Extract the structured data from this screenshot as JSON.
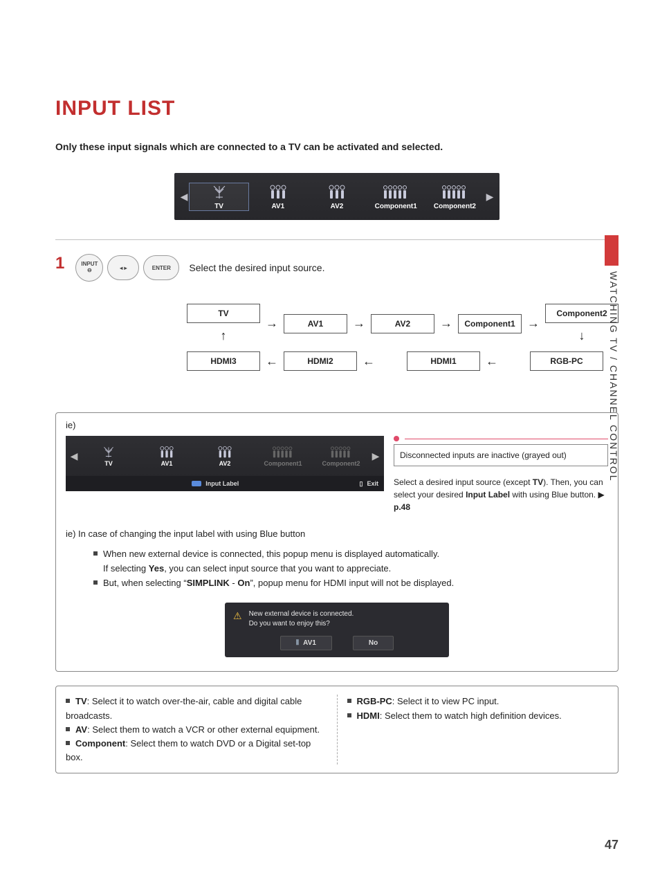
{
  "title": "INPUT LIST",
  "intro": "Only these input signals which are connected to a TV can be activated and selected.",
  "side_label": "WATCHING TV / CHANNEL CONTROL",
  "page_number": "47",
  "top_bar": {
    "items": [
      "TV",
      "AV1",
      "AV2",
      "Component1",
      "Component2"
    ]
  },
  "step1": {
    "num": "1",
    "btn_input": "INPUT",
    "btn_enter": "ENTER",
    "text": "Select the desired input source."
  },
  "flow": {
    "row1": [
      "TV",
      "AV1",
      "AV2",
      "Component1",
      "Component2"
    ],
    "row2": [
      "HDMI3",
      "HDMI2",
      "HDMI1",
      "RGB-PC"
    ]
  },
  "ie": {
    "caption": "ie)",
    "bar_items": [
      "TV",
      "AV1",
      "AV2",
      "Component1",
      "Component2"
    ],
    "grayed_index": [
      3,
      4
    ],
    "input_label_btn": "Input Label",
    "exit_btn": "Exit",
    "callout": "Disconnected inputs are inactive (grayed out)",
    "right_text_1": "Select a desired input source (except ",
    "right_text_1b": "TV",
    "right_text_1c": "). Then, you can select your desired ",
    "right_text_1d": "Input Label",
    "right_text_1e": " with using Blue button. ",
    "right_text_ref": "p.48",
    "sub": "ie) In case of changing the input label with using Blue button",
    "b1a": "When new external device is connected, this popup menu is displayed automatically.",
    "b1b_a": "If selecting ",
    "b1b_b": "Yes",
    "b1b_c": ", you can select input source that you want to appreciate.",
    "b2a": "But, when selecting “",
    "b2b": "SIMPLINK",
    "b2c": " - ",
    "b2d": "On",
    "b2e": "”, popup menu for HDMI input will not be displayed."
  },
  "popup": {
    "line1": "New external device is connected.",
    "line2": "Do you want to enjoy this?",
    "btn_yes": "AV1",
    "btn_no": "No"
  },
  "defs": {
    "tv_b": "TV",
    "tv": ": Select it to watch over-the-air, cable and digital cable broadcasts.",
    "av_b": "AV",
    "av": ": Select them to watch a VCR or other external equipment.",
    "comp_b": "Component",
    "comp": ": Select them to watch DVD or a Digital set-top box.",
    "rgb_b": "RGB-PC",
    "rgb": ": Select it to view PC input.",
    "hdmi_b": "HDMI",
    "hdmi": ": Select them to watch high definition devices."
  }
}
